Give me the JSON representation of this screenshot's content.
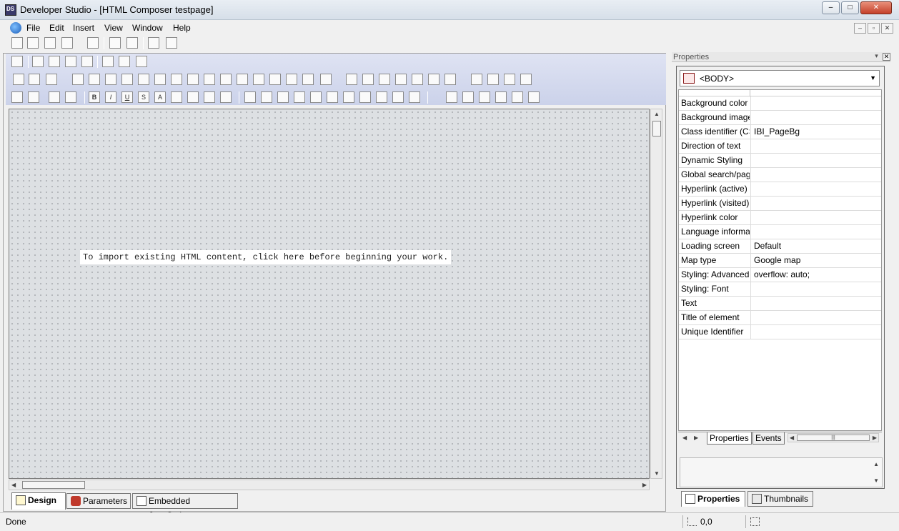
{
  "window": {
    "title": "Developer Studio - [HTML Composer testpage]",
    "minimize": "–",
    "maximize": "□",
    "close": "✕"
  },
  "menu": [
    "File",
    "Edit",
    "Insert",
    "View",
    "Window",
    "Help"
  ],
  "mdi_controls": [
    "–",
    "▫",
    "✕"
  ],
  "editor": {
    "import_hint": "To import existing HTML content, click here before beginning your work.",
    "tabs": [
      {
        "label": "Design",
        "active": true
      },
      {
        "label": "Parameters",
        "active": false
      },
      {
        "label": "Embedded JavaScript",
        "active": false
      }
    ]
  },
  "properties_panel": {
    "title": "Properties",
    "selected_element": "<BODY>",
    "rows": [
      {
        "name": "Background color",
        "value": ""
      },
      {
        "name": "Background image",
        "value": ""
      },
      {
        "name": "Class identifier (CSS)",
        "value": "IBI_PageBg"
      },
      {
        "name": "Direction of text",
        "value": ""
      },
      {
        "name": "Dynamic Styling",
        "value": ""
      },
      {
        "name": "Global search/paging",
        "value": ""
      },
      {
        "name": "Hyperlink (active) color",
        "value": ""
      },
      {
        "name": "Hyperlink (visited) color",
        "value": ""
      },
      {
        "name": "Hyperlink color",
        "value": ""
      },
      {
        "name": "Language information",
        "value": ""
      },
      {
        "name": "Loading screen",
        "value": "Default"
      },
      {
        "name": "Map type",
        "value": "Google map"
      },
      {
        "name": "Styling: Advanced (CSS)",
        "value": "overflow: auto;"
      },
      {
        "name": "Styling: Font",
        "value": ""
      },
      {
        "name": "Text",
        "value": ""
      },
      {
        "name": "Title of element",
        "value": ""
      },
      {
        "name": "Unique Identifier",
        "value": ""
      }
    ],
    "subtabs": [
      "Properties",
      "Events"
    ],
    "bottom_tabs": [
      {
        "label": "Properties",
        "active": true
      },
      {
        "label": "Thumbnails",
        "active": false
      }
    ]
  },
  "statusbar": {
    "text": "Done",
    "coordinates": "0,0"
  },
  "colors": {
    "canvas_bg": "#dde0e3",
    "toolbar_bg": "#d6dcef",
    "close_red": "#c4402a"
  }
}
